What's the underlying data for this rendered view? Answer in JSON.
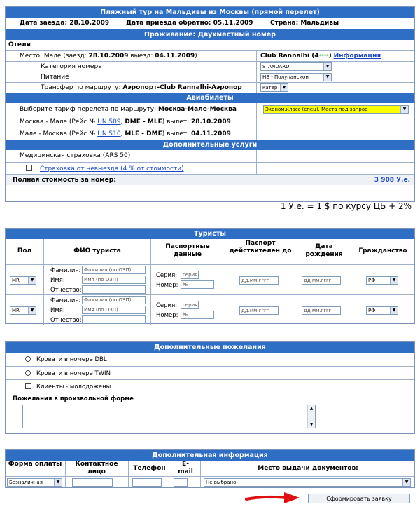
{
  "tour": {
    "title": "Пляжный тур на Мальдивы из Москвы (прямой перелет)",
    "date_in": "Дата заезда: 28.10.2009",
    "date_out": "Дата приезда обратно: 05.11.2009",
    "country": "Страна: Мальдивы",
    "accommodation_header": "Проживание: Двухместный номер",
    "hotels_label": "Отели",
    "place_prefix": "Место: Мале (заезд: ",
    "place_in": "28.10.2009",
    "place_mid": " выезд: ",
    "place_out": "04.11.2009",
    "place_suffix": ")",
    "hotel_name": "Club Rannalhi (4",
    "hotel_stars": "****",
    "hotel_close": ")",
    "info_link": "Информация",
    "room_cat_label": "Категория номера",
    "room_cat_value": "STANDARD",
    "meal_label": "Питание",
    "meal_value": "HB - Полупансион",
    "transfer_prefix": "Трансфер по маршруту: ",
    "transfer_route": "Аэропорт-Club Rannalhi-Аэропор",
    "transfer_value": "катер"
  },
  "flights": {
    "header": "Авиабилеты",
    "tariff_prefix": "Выберите тариф перелета по маршруту: ",
    "tariff_route": "Москва-Мале-Москва",
    "tariff_value": "Эконом.класс (спец). Места под запрос",
    "f1_prefix": "Москва - Мале (Рейс № ",
    "f1_num": "UN 509",
    "f1_route": "DME - MLE",
    "f1_dep": " вылет: ",
    "f1_date": "28.10.2009",
    "f2_prefix": "Мале - Москва (Рейс № ",
    "f2_num": "UN 510",
    "f2_route": "MLE - DME",
    "f2_dep": " вылет: ",
    "f2_date": "04.11.2009"
  },
  "extra": {
    "header": "Дополнительные услуги",
    "medical": "Медицинская страховка (ARS 50)",
    "insurance": "Страховка от невыезда (4 % от стоимости)",
    "total_label": "Полная стоимость за номер:",
    "total_value": "3 908 У.е.",
    "rate_note": "1 У.е. = 1 $ по курсу ЦБ + 2%"
  },
  "tourists": {
    "header": "Туристы",
    "col_sex": "Пол",
    "col_name": "ФИО туриста",
    "col_passport": "Паспортные данные",
    "col_valid": "Паспорт действителен до",
    "col_birth": "Дата рождения",
    "col_citizen": "Гражданство",
    "sex_value": "MR",
    "last_label": "Фамилия:",
    "last_ph": "Фамилия (по ОЗП)",
    "first_label": "Имя:",
    "first_ph": "Имя (по ОЗП)",
    "middle_label": "Отчество:",
    "series_label": "Серия:",
    "series_ph": "серия",
    "number_label": "Номер:",
    "number_ph": "№",
    "date_ph": "дд.мм.гггг",
    "citizen_value": "РФ"
  },
  "wishes": {
    "header": "Дополнительные пожелания",
    "dbl": "Кровати в номере DBL",
    "twin": "Кровати в номере TWIN",
    "newlyweds": "Клиенты - молодожены",
    "free_form": "Пожелания в произвольной форме"
  },
  "info": {
    "header": "Дополнительная информация",
    "col_payment": "Форма оплаты",
    "col_contact": "Контактное лицо",
    "col_phone": "Телефон",
    "col_email": "E-mail",
    "col_docs": "Место выдачи документов:",
    "payment_value": "Безналичная",
    "docs_value": "Не выбрано",
    "submit": "Сформировать заявку"
  },
  "colors": {
    "header_bg": "#2f6ec5",
    "link": "#1a48c4",
    "highlight": "#ffff00",
    "arrow": "#e01010"
  }
}
